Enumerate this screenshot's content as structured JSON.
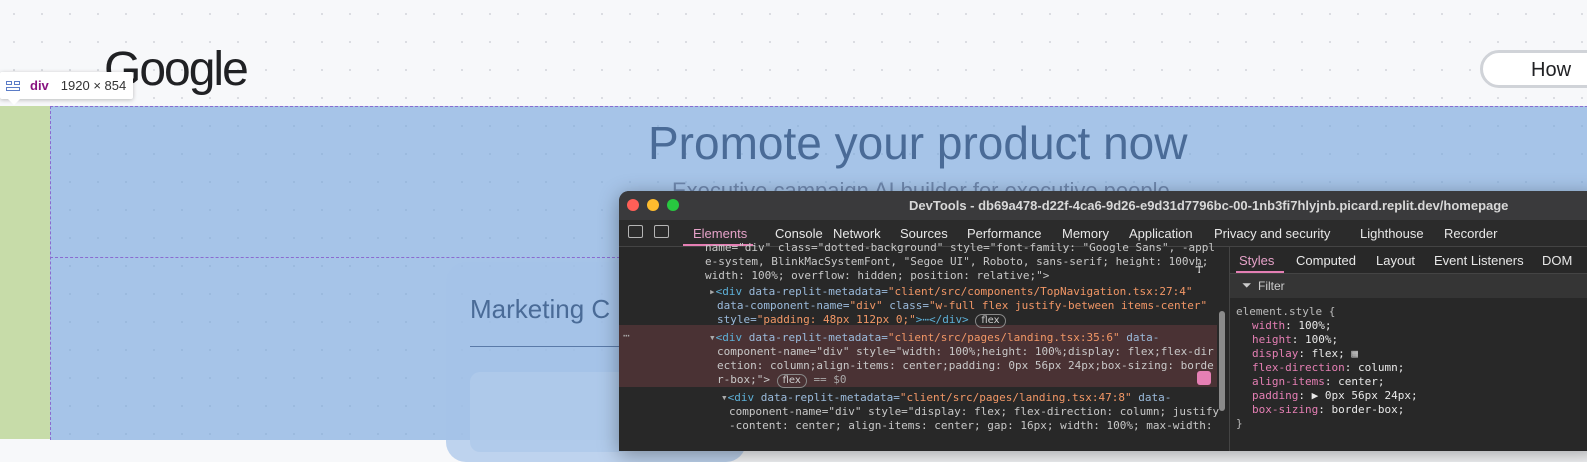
{
  "page": {
    "logo": "Google",
    "how_button": "How",
    "headline": "Promote your product now",
    "subline": "Executive campaign AI builder for executive people",
    "card_title": "Marketing C"
  },
  "inspector_tooltip": {
    "tag": "div",
    "size": "1920 × 854"
  },
  "devtools": {
    "title": "DevTools - db69a478-d22f-4ca6-9d26-e9d31d7796bc-00-1nb3fi7hlyjnb.picard.replit.dev/homepage",
    "tabs": [
      "Elements",
      "Console",
      "Network",
      "Sources",
      "Performance",
      "Memory",
      "Application",
      "Privacy and security",
      "Lighthouse",
      "Recorder"
    ],
    "code": {
      "l1": "name=\"div\" class=\"dotted-background\" style=\"font-family: \"Google Sans\", -appl",
      "l2": "e-system, BlinkMacSystemFont, \"Segoe UI\", Roboto, sans-serif; height: 100vh;",
      "l3": "width: 100%; overflow: hidden; position: relative;\">",
      "l4_tag": "<div ",
      "l4_attr": "data-replit-metadata=",
      "l4_val": "\"client/src/components/TopNavigation.tsx:27:4\"",
      "l5_attr": "data-component-name=",
      "l5_val": "\"div\"",
      "l5_attr2": " class=",
      "l5_val2": "\"w-full flex justify-between items-center\"",
      "l6_attr": "style=",
      "l6_val": "\"padding: 48px 112px 0;\"",
      "l6_end": ">⋯</div>",
      "flex_pill": "flex",
      "l7_tag": "<div ",
      "l7_attr": "data-replit-metadata=",
      "l7_val": "\"client/src/pages/landing.tsx:35:6\"",
      "l7_attr2": " data-",
      "l8": "component-name=\"div\" style=\"width: 100%;height: 100%;display: flex;flex-dir",
      "l9": "ection: column;align-items: center;padding: 0px 56px 24px;box-sizing: borde",
      "l10_a": "r-box;\">",
      "l10_eq": "== $0",
      "l11_tag": "<div ",
      "l11_attr": "data-replit-metadata=",
      "l11_val": "\"client/src/pages/landing.tsx:47:8\"",
      "l11_attr2": " data-",
      "l12": "component-name=\"div\" style=\"display: flex; flex-direction: column; justify",
      "l13": "-content: center; align-items: center; gap: 16px; width: 100%; max-width:"
    },
    "styles_tabs": [
      "Styles",
      "Computed",
      "Layout",
      "Event Listeners",
      "DOM"
    ],
    "filter_placeholder": "Filter",
    "element_style": {
      "selector": "element.style {",
      "props": [
        {
          "name": "width",
          "value": "100%;"
        },
        {
          "name": "height",
          "value": "100%;"
        },
        {
          "name": "display",
          "value": "flex;"
        },
        {
          "name": "flex-direction",
          "value": "column;"
        },
        {
          "name": "align-items",
          "value": "center;"
        },
        {
          "name": "padding",
          "value": "▶ 0px 56px 24px;"
        },
        {
          "name": "box-sizing",
          "value": "border-box;"
        }
      ],
      "close": "}"
    },
    "colors": {
      "close": "#ff5f57",
      "minimize": "#febc2e",
      "zoom": "#28c840"
    }
  }
}
